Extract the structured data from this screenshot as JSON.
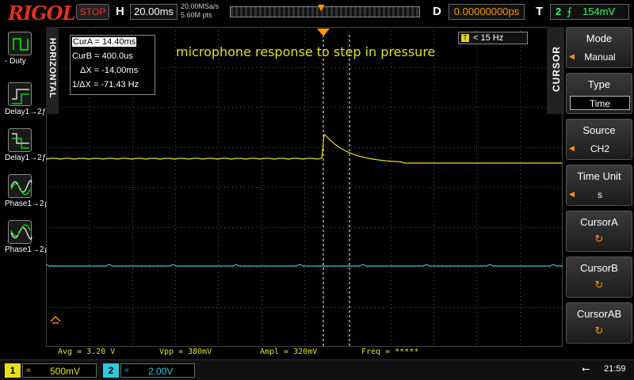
{
  "header": {
    "brand": "RIGOL",
    "run_status": "STOP",
    "horizontal_label": "H",
    "timebase": "20.00ms",
    "sample_rate": "20.00MSa/s",
    "memory_depth": "5.60M pts",
    "delay_label": "D",
    "delay_value": "0.00000000ps",
    "trigger_label": "T",
    "trigger_source": "2",
    "trigger_level": "154mV"
  },
  "left_panel": {
    "tab_label": "HORIZONTAL",
    "tools": [
      {
        "label": "- Duty",
        "icon": "duty-pulse-icon"
      },
      {
        "label": "Delay1→2ƒ",
        "icon": "delay-rise-icon"
      },
      {
        "label": "Delay1→2ƒ",
        "icon": "delay-fall-icon"
      },
      {
        "label": "Phase1→2ƒ",
        "icon": "phase-rise-icon"
      },
      {
        "label": "Phase1→2ƒ",
        "icon": "phase-fall-icon"
      }
    ]
  },
  "cursor_readout": {
    "cur_a": "CurA = 14.40ms",
    "cur_b": "CurB = 400.0us",
    "delta_x": "ΔX = -14.00ms",
    "inv_delta_x": "1/ΔX = -71.43 Hz"
  },
  "annotation": "microphone response to step in pressure",
  "filter_tag": "T",
  "filter_label": "< 15 Hz",
  "measurements": {
    "avg": "Avg = 3.20 V",
    "vpp": "Vpp = 380mV",
    "ampl": "Ampl = 320mV",
    "freq": "Freq = *****"
  },
  "right_panel": {
    "tab_label": "CURSOR",
    "buttons": [
      {
        "title": "Mode",
        "value": "Manual",
        "style": "arrow"
      },
      {
        "title": "Type",
        "value": "Time",
        "style": "boxed"
      },
      {
        "title": "Source",
        "value": "CH2",
        "style": "arrow"
      },
      {
        "title": "Time Unit",
        "value": "s",
        "style": "arrow"
      },
      {
        "title": "CursorA",
        "value": "",
        "style": "knob"
      },
      {
        "title": "CursorB",
        "value": "",
        "style": "knob"
      },
      {
        "title": "CursorAB",
        "value": "",
        "style": "knob"
      }
    ]
  },
  "channels": [
    {
      "number": "1",
      "coupling": "=",
      "scale": "500mV",
      "color": "#e6e020"
    },
    {
      "number": "2",
      "coupling": "=",
      "scale": "2.00V",
      "color": "#30c8d8"
    }
  ],
  "status_bar": {
    "usb_icon": "usb-icon",
    "clock": "21:59"
  },
  "colors": {
    "ch1_trace": "#e6e020",
    "ch2_trace": "#30c8d8",
    "grid": "#555555",
    "trigger_marker": "#ff9900"
  }
}
